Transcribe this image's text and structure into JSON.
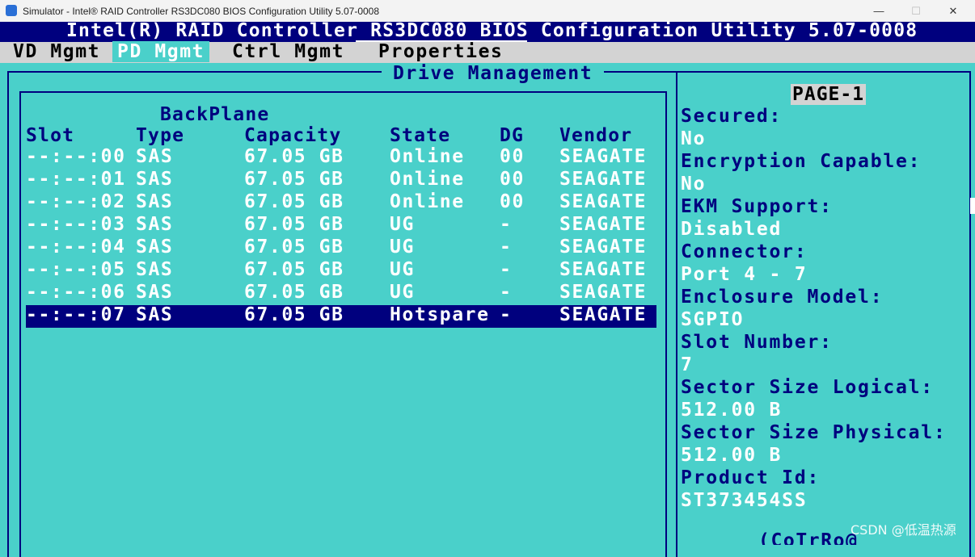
{
  "window": {
    "title": "Simulator - Intel® RAID Controller RS3DC080 BIOS Configuration Utility 5.07-0008",
    "minimize": "—",
    "maximize": "☐",
    "close": "✕"
  },
  "header": {
    "title": "Intel(R) RAID Controller RS3DC080 BIOS Configuration Utility 5.07-0008"
  },
  "menu": {
    "vd_mgmt": "VD Mgmt",
    "pd_mgmt": "PD Mgmt",
    "ctrl_mgmt": "Ctrl Mgmt",
    "properties": "Properties"
  },
  "panel": {
    "title": "Drive Management",
    "group": "BackPlane",
    "columns": {
      "slot": "Slot",
      "type": "Type",
      "capacity": "Capacity",
      "state": "State",
      "dg": "DG",
      "vendor": "Vendor"
    },
    "drives": [
      {
        "slot": "--:--:00",
        "type": "SAS",
        "capacity": "67.05 GB",
        "state": "Online",
        "dg": "00",
        "vendor": "SEAGATE"
      },
      {
        "slot": "--:--:01",
        "type": "SAS",
        "capacity": "67.05 GB",
        "state": "Online",
        "dg": "00",
        "vendor": "SEAGATE"
      },
      {
        "slot": "--:--:02",
        "type": "SAS",
        "capacity": "67.05 GB",
        "state": "Online",
        "dg": "00",
        "vendor": "SEAGATE"
      },
      {
        "slot": "--:--:03",
        "type": "SAS",
        "capacity": "67.05 GB",
        "state": "UG",
        "dg": "-",
        "vendor": "SEAGATE"
      },
      {
        "slot": "--:--:04",
        "type": "SAS",
        "capacity": "67.05 GB",
        "state": "UG",
        "dg": "-",
        "vendor": "SEAGATE"
      },
      {
        "slot": "--:--:05",
        "type": "SAS",
        "capacity": "67.05 GB",
        "state": "UG",
        "dg": "-",
        "vendor": "SEAGATE"
      },
      {
        "slot": "--:--:06",
        "type": "SAS",
        "capacity": "67.05 GB",
        "state": "UG",
        "dg": "-",
        "vendor": "SEAGATE"
      },
      {
        "slot": "--:--:07",
        "type": "SAS",
        "capacity": "67.05 GB",
        "state": "Hotspare",
        "dg": "-",
        "vendor": "SEAGATE"
      }
    ]
  },
  "properties": {
    "page": "PAGE-1",
    "items": [
      {
        "label": "Secured:",
        "value": "No"
      },
      {
        "label": "Encryption Capable:",
        "value": "No"
      },
      {
        "label": "EKM Support:",
        "value": "Disabled"
      },
      {
        "label": "Connector:",
        "value": "Port 4 - 7"
      },
      {
        "label": "Enclosure Model:",
        "value": "SGPIO"
      },
      {
        "label": "Slot Number:",
        "value": "7"
      },
      {
        "label": "Sector Size Logical:",
        "value": "512.00 B"
      },
      {
        "label": "Sector Size Physical:",
        "value": "512.00 B"
      },
      {
        "label": "Product Id:",
        "value": "ST373454SS"
      }
    ],
    "more": "(CoTrRo@"
  },
  "watermark": "CSDN @低温热源",
  "colors": {
    "background": "#4ad0ca",
    "header": "#00007e",
    "menubar": "#d3d3d3",
    "text_value": "#ffffff"
  }
}
